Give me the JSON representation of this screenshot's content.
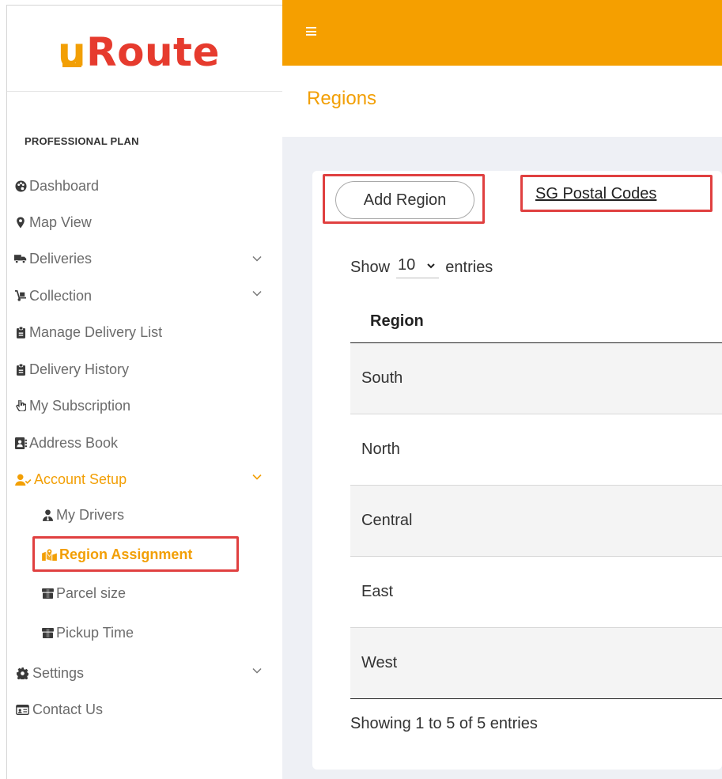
{
  "brand": {
    "logo_u": "u",
    "logo_rest": "Route"
  },
  "sidebar": {
    "plan": "PROFESSIONAL PLAN",
    "items": [
      {
        "label": "Dashboard",
        "icon": "palette-icon"
      },
      {
        "label": "Map View",
        "icon": "map-marker-icon"
      },
      {
        "label": "Deliveries",
        "icon": "truck-icon"
      },
      {
        "label": "Collection",
        "icon": "dolly-icon"
      },
      {
        "label": "Manage Delivery List",
        "icon": "clipboard-icon"
      },
      {
        "label": "Delivery History",
        "icon": "clipboard-icon"
      },
      {
        "label": "My Subscription",
        "icon": "hand-pointer-icon"
      },
      {
        "label": "Address Book",
        "icon": "address-book-icon"
      },
      {
        "label": "Account Setup",
        "icon": "user-check-icon"
      },
      {
        "label": "My Drivers",
        "icon": "user-tie-icon"
      },
      {
        "label": "Region Assignment",
        "icon": "map-location-icon"
      },
      {
        "label": "Parcel size",
        "icon": "box-icon"
      },
      {
        "label": "Pickup Time",
        "icon": "box-icon"
      },
      {
        "label": "Settings",
        "icon": "gear-icon"
      },
      {
        "label": "Contact Us",
        "icon": "contact-card-icon"
      }
    ]
  },
  "header": {
    "title": "Regions"
  },
  "toolbar": {
    "add_label": "Add Region",
    "postal_link": "SG Postal Codes"
  },
  "entries": {
    "show": "Show",
    "value": "10",
    "suffix": "entries"
  },
  "table": {
    "columns": [
      "Region"
    ],
    "rows": [
      "South",
      "North",
      "Central",
      "East",
      "West"
    ]
  },
  "info": "Showing 1 to 5 of 5 entries",
  "colors": {
    "accent": "#f59f00",
    "brand_red": "#e63b2e",
    "highlight": "#e04040"
  }
}
